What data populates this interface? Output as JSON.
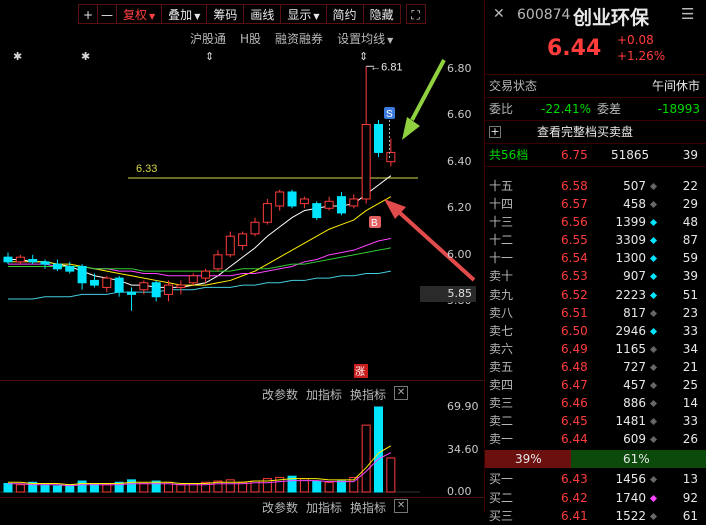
{
  "toolbar": {
    "items": [
      {
        "label": "+",
        "active": false
      },
      {
        "label": "—",
        "active": false
      },
      {
        "label": "复权",
        "active": true,
        "caret": true
      },
      {
        "label": "叠加",
        "active": false,
        "caret": true
      },
      {
        "label": "筹码",
        "active": false
      },
      {
        "label": "画线",
        "active": false
      },
      {
        "label": "显示",
        "active": false,
        "caret": true
      },
      {
        "label": "简约",
        "active": false
      },
      {
        "label": "隐藏",
        "active": false
      }
    ],
    "expand_icon": "expand-icon"
  },
  "subbar": {
    "items": [
      "沪股通",
      "H股",
      "融资融券",
      "设置均线"
    ]
  },
  "chart_data": [
    {
      "type": "candlestick",
      "ylim": [
        5.72,
        6.88
      ],
      "y_ticks": [
        "6.80",
        "6.60",
        "6.40",
        "6.20",
        "6.00",
        "5.80"
      ],
      "current_price_label": "5.85",
      "high_annotation": "6.81",
      "support_line_label": "6.33",
      "buy_marker": "B",
      "sell_marker": "S",
      "limit_up_badge": "涨",
      "candles": [
        {
          "o": 5.99,
          "h": 6.01,
          "l": 5.96,
          "c": 5.97
        },
        {
          "o": 5.97,
          "h": 6.0,
          "l": 5.96,
          "c": 5.99
        },
        {
          "o": 5.98,
          "h": 6.0,
          "l": 5.96,
          "c": 5.97
        },
        {
          "o": 5.97,
          "h": 5.98,
          "l": 5.94,
          "c": 5.96
        },
        {
          "o": 5.96,
          "h": 5.98,
          "l": 5.93,
          "c": 5.94
        },
        {
          "o": 5.95,
          "h": 5.97,
          "l": 5.92,
          "c": 5.93
        },
        {
          "o": 5.95,
          "h": 5.96,
          "l": 5.85,
          "c": 5.88
        },
        {
          "o": 5.89,
          "h": 5.92,
          "l": 5.86,
          "c": 5.87
        },
        {
          "o": 5.86,
          "h": 5.91,
          "l": 5.84,
          "c": 5.9
        },
        {
          "o": 5.9,
          "h": 5.91,
          "l": 5.82,
          "c": 5.84
        },
        {
          "o": 5.84,
          "h": 5.86,
          "l": 5.76,
          "c": 5.83
        },
        {
          "o": 5.85,
          "h": 5.89,
          "l": 5.83,
          "c": 5.88
        },
        {
          "o": 5.88,
          "h": 5.89,
          "l": 5.8,
          "c": 5.82
        },
        {
          "o": 5.83,
          "h": 5.89,
          "l": 5.8,
          "c": 5.87
        },
        {
          "o": 5.86,
          "h": 5.89,
          "l": 5.83,
          "c": 5.87
        },
        {
          "o": 5.88,
          "h": 5.92,
          "l": 5.87,
          "c": 5.91
        },
        {
          "o": 5.9,
          "h": 5.94,
          "l": 5.88,
          "c": 5.93
        },
        {
          "o": 5.94,
          "h": 6.02,
          "l": 5.93,
          "c": 6.0
        },
        {
          "o": 6.0,
          "h": 6.1,
          "l": 5.99,
          "c": 6.08
        },
        {
          "o": 6.04,
          "h": 6.1,
          "l": 6.02,
          "c": 6.09
        },
        {
          "o": 6.09,
          "h": 6.16,
          "l": 6.08,
          "c": 6.14
        },
        {
          "o": 6.14,
          "h": 6.24,
          "l": 6.13,
          "c": 6.22
        },
        {
          "o": 6.21,
          "h": 6.28,
          "l": 6.19,
          "c": 6.27
        },
        {
          "o": 6.27,
          "h": 6.28,
          "l": 6.2,
          "c": 6.21
        },
        {
          "o": 6.22,
          "h": 6.25,
          "l": 6.2,
          "c": 6.24
        },
        {
          "o": 6.22,
          "h": 6.23,
          "l": 6.15,
          "c": 6.16
        },
        {
          "o": 6.2,
          "h": 6.25,
          "l": 6.19,
          "c": 6.23
        },
        {
          "o": 6.25,
          "h": 6.27,
          "l": 6.17,
          "c": 6.18
        },
        {
          "o": 6.21,
          "h": 6.26,
          "l": 6.2,
          "c": 6.24
        },
        {
          "o": 6.24,
          "h": 6.81,
          "l": 6.22,
          "c": 6.56
        },
        {
          "o": 6.56,
          "h": 6.58,
          "l": 6.42,
          "c": 6.44
        },
        {
          "o": 6.4,
          "h": 6.5,
          "l": 6.38,
          "c": 6.44
        }
      ],
      "ma_series": [
        {
          "color": "#ffffff",
          "values": [
            5.98,
            5.98,
            5.97,
            5.97,
            5.96,
            5.95,
            5.93,
            5.91,
            5.9,
            5.89,
            5.87,
            5.87,
            5.86,
            5.86,
            5.86,
            5.87,
            5.88,
            5.91,
            5.95,
            5.99,
            6.03,
            6.08,
            6.12,
            6.16,
            6.19,
            6.2,
            6.21,
            6.21,
            6.22,
            6.26,
            6.3,
            6.34
          ]
        },
        {
          "color": "#ffee00",
          "values": [
            5.97,
            5.97,
            5.97,
            5.97,
            5.96,
            5.96,
            5.95,
            5.94,
            5.93,
            5.92,
            5.91,
            5.9,
            5.89,
            5.88,
            5.87,
            5.87,
            5.87,
            5.88,
            5.89,
            5.91,
            5.93,
            5.96,
            5.99,
            6.02,
            6.05,
            6.08,
            6.11,
            6.13,
            6.15,
            6.19,
            6.22,
            6.25
          ]
        },
        {
          "color": "#ff44ff",
          "values": [
            5.96,
            5.96,
            5.96,
            5.96,
            5.95,
            5.95,
            5.95,
            5.94,
            5.94,
            5.93,
            5.93,
            5.92,
            5.92,
            5.91,
            5.91,
            5.91,
            5.91,
            5.91,
            5.91,
            5.92,
            5.92,
            5.93,
            5.94,
            5.95,
            5.97,
            5.98,
            6.0,
            6.01,
            6.02,
            6.04,
            6.06,
            6.07
          ]
        },
        {
          "color": "#33cc33",
          "values": [
            5.95,
            5.95,
            5.95,
            5.95,
            5.95,
            5.95,
            5.95,
            5.94,
            5.94,
            5.94,
            5.94,
            5.93,
            5.93,
            5.93,
            5.93,
            5.93,
            5.93,
            5.93,
            5.93,
            5.94,
            5.94,
            5.94,
            5.95,
            5.96,
            5.96,
            5.97,
            5.98,
            5.99,
            6.0,
            6.01,
            6.02,
            6.03
          ]
        },
        {
          "color": "#44ccdd",
          "values": [
            5.81,
            5.81,
            5.81,
            5.82,
            5.82,
            5.82,
            5.83,
            5.83,
            5.83,
            5.84,
            5.84,
            5.84,
            5.84,
            5.85,
            5.85,
            5.85,
            5.86,
            5.86,
            5.86,
            5.87,
            5.87,
            5.88,
            5.88,
            5.89,
            5.89,
            5.9,
            5.9,
            5.91,
            5.91,
            5.92,
            5.92,
            5.93
          ]
        }
      ]
    },
    {
      "type": "bar",
      "ylim": [
        0,
        69.9
      ],
      "y_ticks": [
        "69.90",
        "34.60",
        "0.00"
      ],
      "values": [
        7,
        6,
        8,
        6,
        5,
        6,
        9,
        7,
        6,
        8,
        10,
        7,
        9,
        8,
        6,
        7,
        8,
        9,
        10,
        8,
        9,
        11,
        12,
        13,
        11,
        9,
        8,
        9,
        12,
        55,
        69.9,
        28
      ],
      "up": [
        false,
        true,
        false,
        false,
        false,
        false,
        false,
        false,
        true,
        false,
        false,
        true,
        false,
        true,
        true,
        true,
        true,
        true,
        true,
        true,
        true,
        true,
        true,
        false,
        true,
        false,
        true,
        false,
        true,
        true,
        false,
        true
      ],
      "line": [
        8,
        8,
        7,
        7,
        7,
        6,
        7,
        7,
        7,
        7,
        8,
        8,
        8,
        8,
        7,
        7,
        7,
        8,
        8,
        8,
        9,
        9,
        10,
        11,
        11,
        11,
        10,
        10,
        10,
        20,
        32,
        38
      ]
    }
  ],
  "indicator_bar": {
    "items": [
      "改参数",
      "加指标",
      "换指标"
    ],
    "close": "✕"
  },
  "quote": {
    "code": "600874",
    "name": "创业环保",
    "price": "6.44",
    "change": "+0.08",
    "pct": "+1.26%"
  },
  "status": {
    "label": "交易状态",
    "value": "午间休市"
  },
  "ratio": {
    "wb_label": "委比",
    "wb_value": "-22.41%",
    "wc_label": "委差",
    "wc_value": "-18993"
  },
  "full_orderbook_label": "查看完整档买卖盘",
  "levels_summary": {
    "label": "共56档",
    "price": "6.75",
    "vol": "51865",
    "count": "39"
  },
  "asks": [
    {
      "label": "十五",
      "price": "6.58",
      "vol": "507",
      "mark": "gray",
      "count": "22"
    },
    {
      "label": "十四",
      "price": "6.57",
      "vol": "458",
      "mark": "gray",
      "count": "29"
    },
    {
      "label": "十三",
      "price": "6.56",
      "vol": "1399",
      "mark": "cyan",
      "count": "48"
    },
    {
      "label": "十二",
      "price": "6.55",
      "vol": "3309",
      "mark": "cyan",
      "count": "87"
    },
    {
      "label": "十一",
      "price": "6.54",
      "vol": "1300",
      "mark": "cyan",
      "count": "59"
    },
    {
      "label": "卖十",
      "price": "6.53",
      "vol": "907",
      "mark": "cyan",
      "count": "39"
    },
    {
      "label": "卖九",
      "price": "6.52",
      "vol": "2223",
      "mark": "cyan",
      "count": "51"
    },
    {
      "label": "卖八",
      "price": "6.51",
      "vol": "817",
      "mark": "gray",
      "count": "23"
    },
    {
      "label": "卖七",
      "price": "6.50",
      "vol": "2946",
      "mark": "cyan",
      "count": "33"
    },
    {
      "label": "卖六",
      "price": "6.49",
      "vol": "1165",
      "mark": "gray",
      "count": "34"
    },
    {
      "label": "卖五",
      "price": "6.48",
      "vol": "727",
      "mark": "gray",
      "count": "21"
    },
    {
      "label": "卖四",
      "price": "6.47",
      "vol": "457",
      "mark": "gray",
      "count": "25"
    },
    {
      "label": "卖三",
      "price": "6.46",
      "vol": "886",
      "mark": "gray",
      "count": "14"
    },
    {
      "label": "卖二",
      "price": "6.45",
      "vol": "1481",
      "mark": "gray",
      "count": "33"
    },
    {
      "label": "卖一",
      "price": "6.44",
      "vol": "609",
      "mark": "gray",
      "count": "26"
    }
  ],
  "power": {
    "buy": "39%",
    "sell": "61%",
    "buy_fraction": 0.39
  },
  "bids": [
    {
      "label": "买一",
      "price": "6.43",
      "vol": "1456",
      "mark": "gray",
      "count": "13"
    },
    {
      "label": "买二",
      "price": "6.42",
      "vol": "1740",
      "mark": "magenta",
      "count": "92"
    },
    {
      "label": "买三",
      "price": "6.41",
      "vol": "1522",
      "mark": "gray",
      "count": "61"
    }
  ],
  "colors": {
    "up": "#ff3c3c",
    "down": "#00e5ff",
    "green": "#00d800",
    "cyan": "#00e5ff",
    "magenta": "#ff44ff",
    "gray": "#888888",
    "annot_green": "#8fd13f",
    "annot_red": "#e24b4b"
  }
}
